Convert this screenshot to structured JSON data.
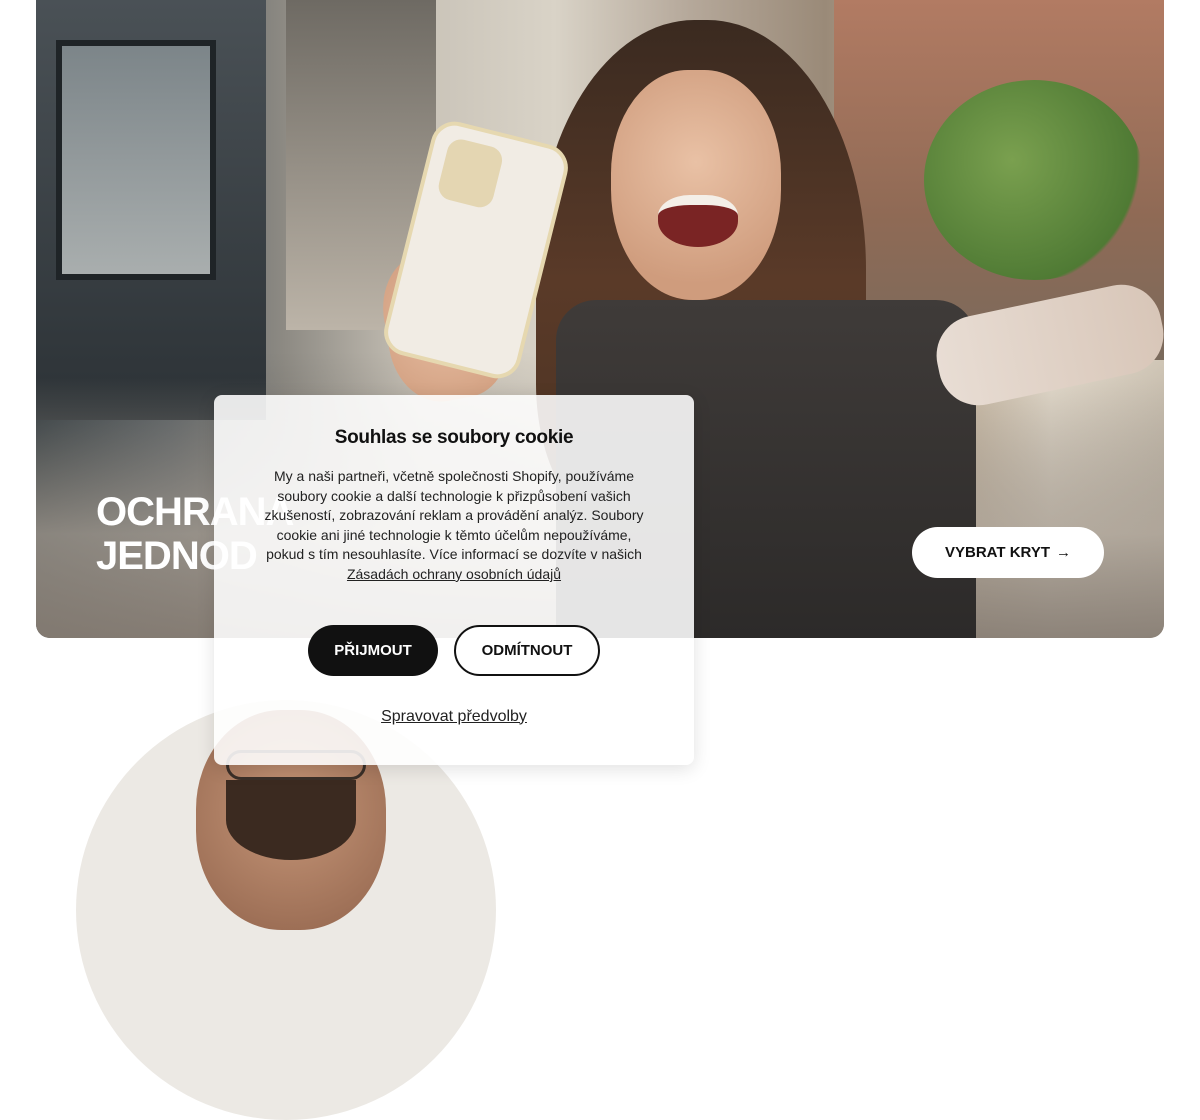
{
  "hero": {
    "title_line1": "OCHRANA",
    "title_line2": "JEDNOD",
    "cta_label": "VYBRAT KRYT",
    "cta_icon": "arrow-right-icon"
  },
  "cookie": {
    "title": "Souhlas se soubory cookie",
    "text": "My a naši partneři, včetně společnosti Shopify, používáme soubory cookie a další technologie k přizpůsobení vašich zkušeností, zobrazování reklam a provádění analýz. Soubory cookie ani jiné technologie k těmto účelům nepoužíváme, pokud s tím nesouhlasíte. Více informací se dozvíte v našich ",
    "link_text": "Zásadách ochrany osobních údajů",
    "accept_label": "PŘIJMOUT",
    "decline_label": "ODMÍTNOUT",
    "manage_label": "Spravovat předvolby"
  },
  "colors": {
    "primary": "#111111",
    "background": "#ffffff",
    "modal": "#ffffff"
  }
}
